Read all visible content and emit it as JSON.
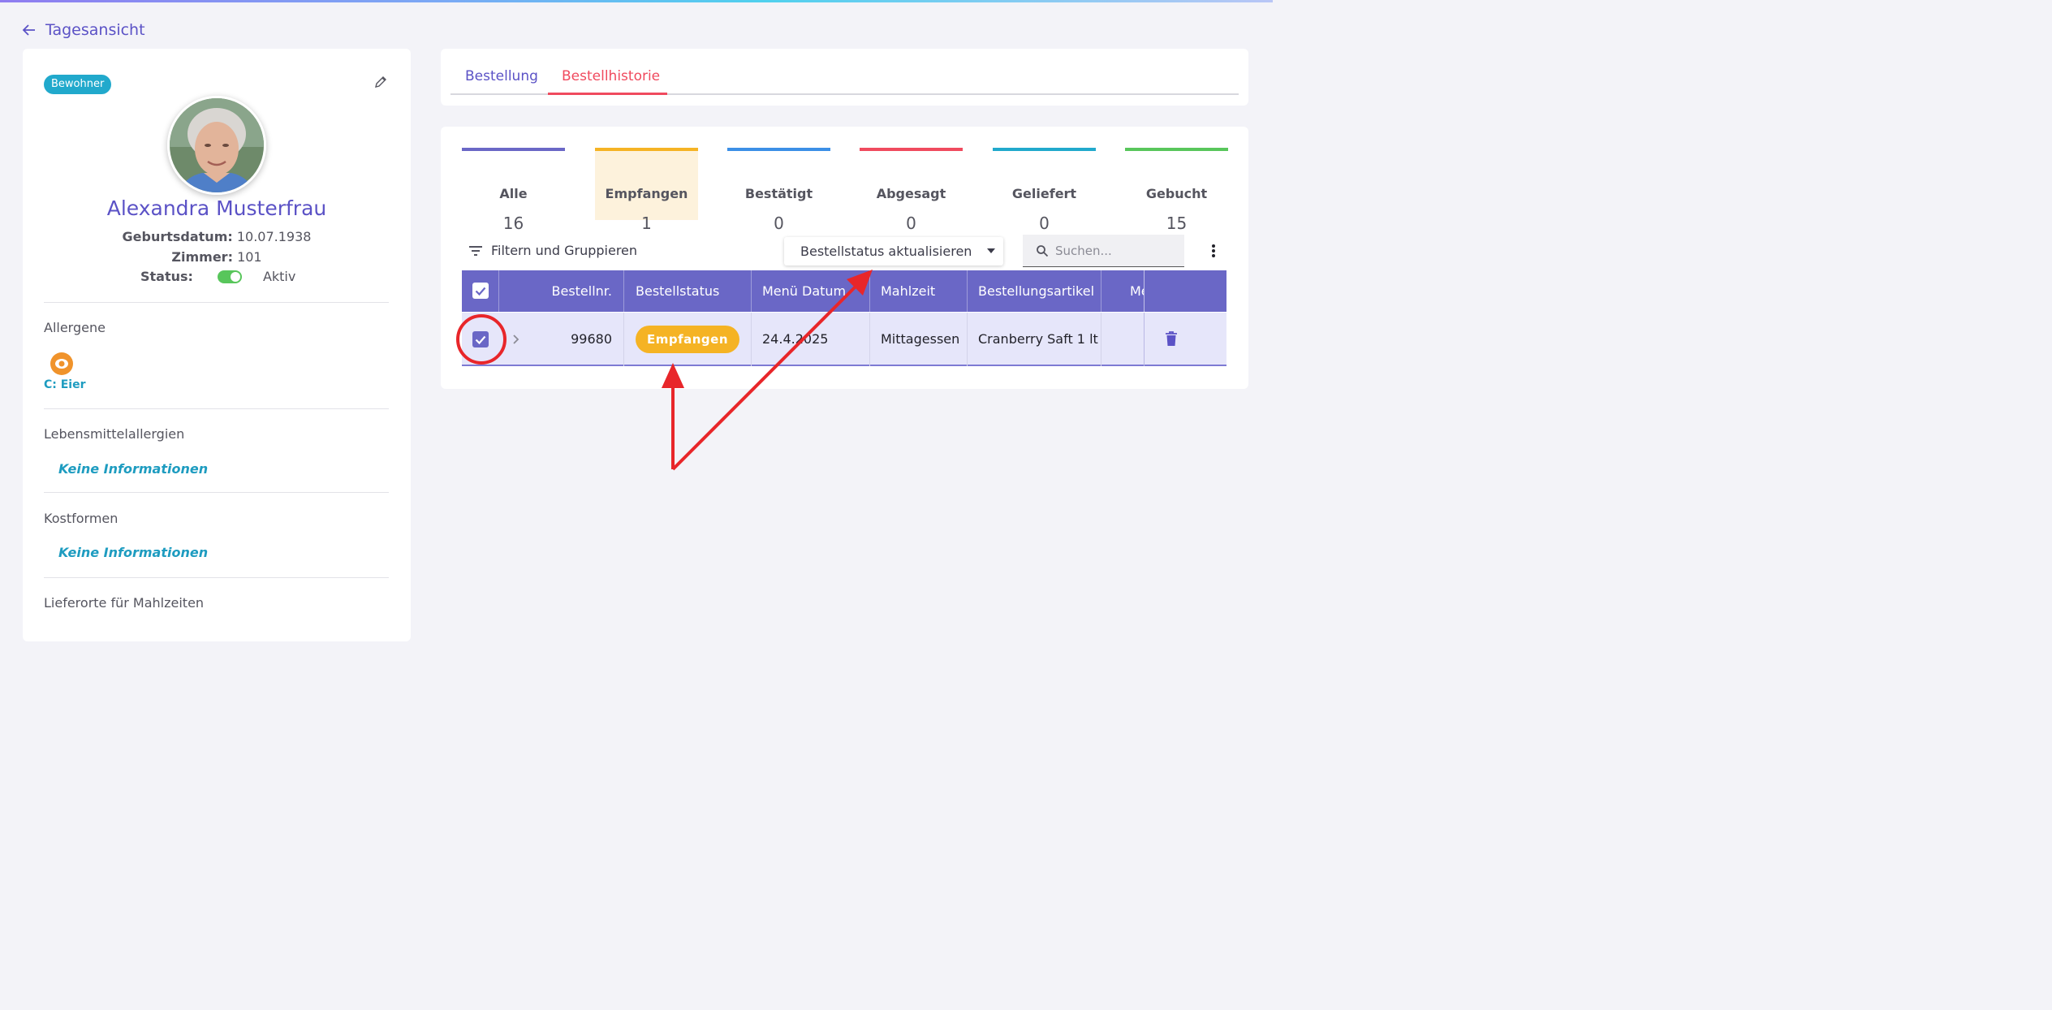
{
  "nav": {
    "back_label": "Tagesansicht"
  },
  "profile": {
    "role_badge": "Bewohner",
    "name": "Alexandra Musterfrau",
    "birth_label": "Geburtsdatum:",
    "birth_value": "10.07.1938",
    "room_label": "Zimmer:",
    "room_value": "101",
    "status_label": "Status:",
    "status_value": "Aktiv",
    "status_on": true
  },
  "sections": {
    "allergens_title": "Allergene",
    "allergen_item": "C: Eier",
    "food_allergies_title": "Lebensmittelallergien",
    "food_allergies_value": "Keine Informationen",
    "diets_title": "Kostformen",
    "diets_value": "Keine Informationen",
    "delivery_title": "Lieferorte für Mahlzeiten"
  },
  "tabs": [
    {
      "label": "Bestellung",
      "active": false
    },
    {
      "label": "Bestellhistorie",
      "active": true
    }
  ],
  "stats": [
    {
      "label": "Alle",
      "count": "16",
      "color": "#6a67c6"
    },
    {
      "label": "Empfangen",
      "count": "1",
      "color": "#f5b324",
      "selected": true
    },
    {
      "label": "Bestätigt",
      "count": "0",
      "color": "#3b8fe6"
    },
    {
      "label": "Abgesagt",
      "count": "0",
      "color": "#f04a5e"
    },
    {
      "label": "Geliefert",
      "count": "0",
      "color": "#21a9cc"
    },
    {
      "label": "Gebucht",
      "count": "15",
      "color": "#58c65b"
    }
  ],
  "toolbar": {
    "filter_label": "Filtern und Gruppieren",
    "status_update_label": "Bestellstatus aktualisieren",
    "search_placeholder": "Suchen..."
  },
  "table": {
    "columns": [
      "Bestellnr.",
      "Bestellstatus",
      "Menü Datum",
      "Mahlzeit",
      "Bestellungsartikel",
      "Me"
    ],
    "rows": [
      {
        "order_no": "99680",
        "status": "Empfangen",
        "menu_date": "24.4.2025",
        "meal": "Mittagessen",
        "item": "Cranberry Saft 1 lt",
        "selected": true
      }
    ]
  },
  "colors": {
    "accent": "#5b52c6",
    "header": "#6a67c6",
    "row_selected": "#e6e6fa",
    "annotation": "#e8262a"
  }
}
